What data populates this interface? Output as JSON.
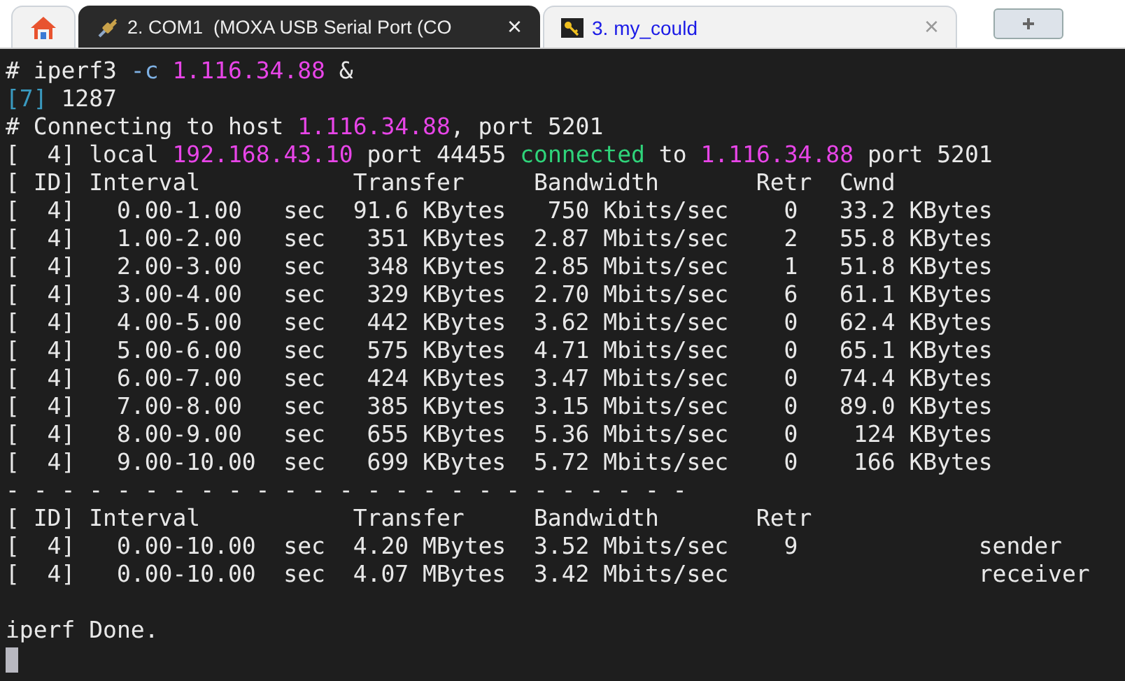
{
  "tabs": [
    {
      "kind": "home",
      "selected": false
    },
    {
      "kind": "serial",
      "label": "2. COM1  (MOXA USB Serial Port (CO",
      "close": "×",
      "selected": true
    },
    {
      "kind": "ssh",
      "label": "3. my_could",
      "close": "×",
      "selected": false
    },
    {
      "kind": "new",
      "selected": false
    }
  ],
  "terminal": {
    "lines": [
      {
        "segments": [
          {
            "text": "# iperf3 "
          },
          {
            "text": "-c ",
            "color": "#7fb2e5"
          },
          {
            "text": "1.116.34.88",
            "color": "#e845e8"
          },
          {
            "text": " &"
          }
        ]
      },
      {
        "segments": [
          {
            "text": "[7]",
            "color": "#3a9ac0"
          },
          {
            "text": " 1287"
          }
        ]
      },
      {
        "segments": [
          {
            "text": "# Connecting to host "
          },
          {
            "text": "1.116.34.88",
            "color": "#e845e8"
          },
          {
            "text": ", port 5201"
          }
        ]
      },
      {
        "segments": [
          {
            "text": "[  4] local "
          },
          {
            "text": "192.168.43.10",
            "color": "#e845e8"
          },
          {
            "text": " port 44455 "
          },
          {
            "text": "connected",
            "color": "#2fd47a"
          },
          {
            "text": " to "
          },
          {
            "text": "1.116.34.88",
            "color": "#e845e8"
          },
          {
            "text": " port 5201"
          }
        ]
      },
      {
        "segments": [
          {
            "text": "[ ID] Interval           Transfer     Bandwidth       Retr  Cwnd"
          }
        ]
      },
      {
        "segments": [
          {
            "text": "[  4]   0.00-1.00   sec  91.6 KBytes   750 Kbits/sec    0   33.2 KBytes"
          }
        ]
      },
      {
        "segments": [
          {
            "text": "[  4]   1.00-2.00   sec   351 KBytes  2.87 Mbits/sec    2   55.8 KBytes"
          }
        ]
      },
      {
        "segments": [
          {
            "text": "[  4]   2.00-3.00   sec   348 KBytes  2.85 Mbits/sec    1   51.8 KBytes"
          }
        ]
      },
      {
        "segments": [
          {
            "text": "[  4]   3.00-4.00   sec   329 KBytes  2.70 Mbits/sec    6   61.1 KBytes"
          }
        ]
      },
      {
        "segments": [
          {
            "text": "[  4]   4.00-5.00   sec   442 KBytes  3.62 Mbits/sec    0   62.4 KBytes"
          }
        ]
      },
      {
        "segments": [
          {
            "text": "[  4]   5.00-6.00   sec   575 KBytes  4.71 Mbits/sec    0   65.1 KBytes"
          }
        ]
      },
      {
        "segments": [
          {
            "text": "[  4]   6.00-7.00   sec   424 KBytes  3.47 Mbits/sec    0   74.4 KBytes"
          }
        ]
      },
      {
        "segments": [
          {
            "text": "[  4]   7.00-8.00   sec   385 KBytes  3.15 Mbits/sec    0   89.0 KBytes"
          }
        ]
      },
      {
        "segments": [
          {
            "text": "[  4]   8.00-9.00   sec   655 KBytes  5.36 Mbits/sec    0    124 KBytes"
          }
        ]
      },
      {
        "segments": [
          {
            "text": "[  4]   9.00-10.00  sec   699 KBytes  5.72 Mbits/sec    0    166 KBytes"
          }
        ]
      },
      {
        "segments": [
          {
            "text": "- - - - - - - - - - - - - - - - - - - - - - - - -"
          }
        ]
      },
      {
        "segments": [
          {
            "text": "[ ID] Interval           Transfer     Bandwidth       Retr"
          }
        ]
      },
      {
        "segments": [
          {
            "text": "[  4]   0.00-10.00  sec  4.20 MBytes  3.52 Mbits/sec    9             sender"
          }
        ]
      },
      {
        "segments": [
          {
            "text": "[  4]   0.00-10.00  sec  4.07 MBytes  3.42 Mbits/sec                  receiver"
          }
        ]
      },
      {
        "blank_before": true,
        "segments": [
          {
            "text": "iperf Done."
          }
        ]
      }
    ],
    "cursor": true
  }
}
